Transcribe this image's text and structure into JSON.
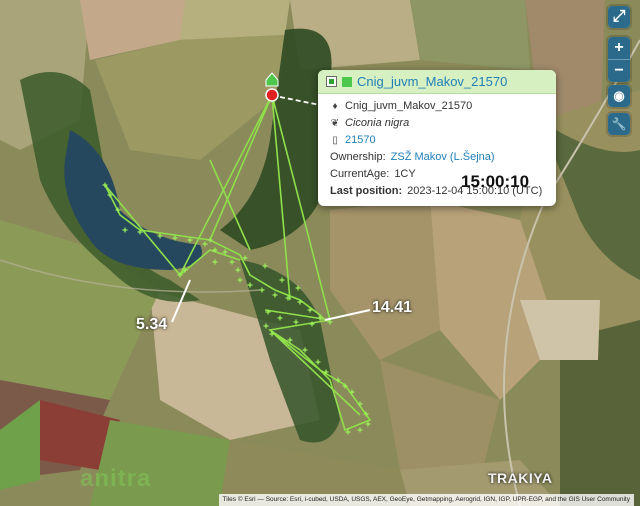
{
  "popup": {
    "title": "Cnig_juvm_Makov_21570",
    "tag_name": "Cnig_juvm_Makov_21570",
    "species": "Ciconia nigra",
    "device_id": "21570",
    "ownership_label": "Ownership:",
    "ownership_value": "ZSŽ Makov (L.Šejna)",
    "age_label": "CurrentAge:",
    "age_value": "1CY",
    "last_position_label": "Last position:",
    "last_position_value": "2023-12-04 15:00:10 (UTC)"
  },
  "overlay_time": "15:00:10",
  "annotations": {
    "left_label": "5.34",
    "right_label": "14.41"
  },
  "place_label": "TRAKIYA",
  "logo_text": "anitra",
  "attribution": "Tiles © Esri — Source: Esri, i-cubed, USDA, USGS, AEX, GeoEye, Getmapping, Aerogrid, IGN, IGP, UPR-EGP, and the GIS User Community",
  "controls": {
    "fullscreen": "⤢",
    "zoom_in": "+",
    "zoom_out": "−",
    "locate": "◉",
    "settings": "🔧"
  },
  "colors": {
    "track": "#8fe04a",
    "current_position": "#e02020",
    "popup_header": "#d7f0c2",
    "link": "#1f7fb8"
  }
}
